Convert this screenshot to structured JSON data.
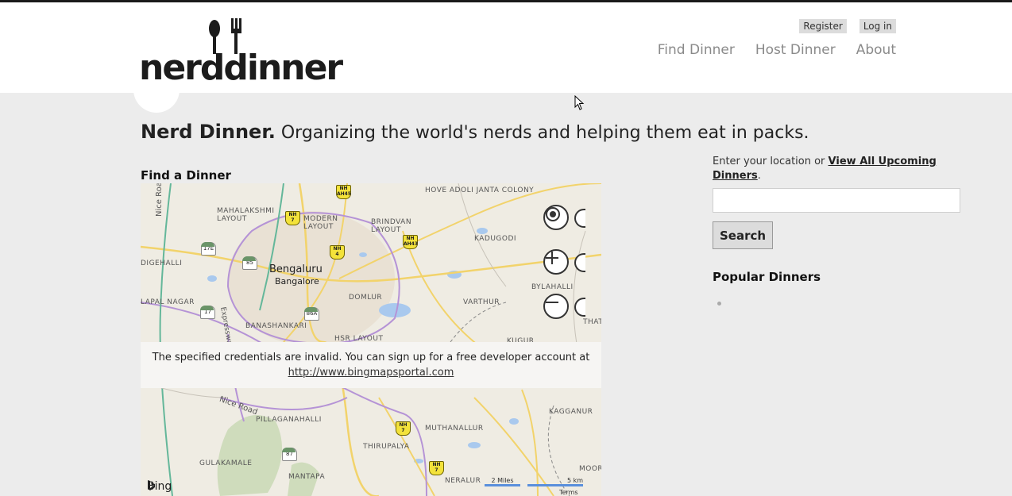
{
  "header": {
    "logo_text": "nerddinner",
    "login_links": [
      "Register",
      "Log in"
    ],
    "nav": [
      "Find Dinner",
      "Host Dinner",
      "About"
    ]
  },
  "tagline": {
    "bold": "Nerd Dinner.",
    "rest": " Organizing the world's nerds and helping them eat in packs."
  },
  "main": {
    "find_heading": "Find a Dinner"
  },
  "map": {
    "city_primary": "Bengaluru",
    "city_secondary": "Bangalore",
    "area_labels": [
      "HOVE ADOLI JANTA COLONY",
      "MAHALAKSHMI LAYOUT",
      "MODERN LAYOUT",
      "BRINDVAN LAYOUT",
      "KADUGODI",
      "DIGEHALLI",
      "BYLAHALLI",
      "LAPAL NAGAR",
      "DOMLUR",
      "VARTHUR",
      "BANASHANKARI",
      "KUGUR",
      "THAT",
      "HSR LAYOUT",
      "PILLAGANAHALLI",
      "KAGGANUR",
      "MUTHANALLUR",
      "THIRUPALYA",
      "GULAKAMALE",
      "MOOR",
      "MANTAPA",
      "NERALUR"
    ],
    "road_labels": [
      "Nice Road",
      "Nice Road",
      "Expressway"
    ],
    "shields_yellow": [
      "AH45",
      "7",
      "4",
      "AH43",
      "7",
      "7"
    ],
    "shields_green": [
      "17E",
      "85",
      "17",
      "86A",
      "87"
    ],
    "credentials_message": "The specified credentials are invalid. You can sign up for a free developer account at",
    "credentials_link": "http://www.bingmapsportal.com",
    "brand": "Bing",
    "scale_miles": "2 Miles",
    "scale_km": "5 km",
    "terms": "Terms",
    "controls": [
      "locate-me",
      "zoom-in",
      "zoom-out"
    ]
  },
  "sidebar": {
    "location_prompt": "Enter your location or ",
    "view_all_link": "View All Upcoming Dinners",
    "after_link": ".",
    "search_value": "",
    "search_button": "Search",
    "popular_heading": "Popular Dinners"
  }
}
